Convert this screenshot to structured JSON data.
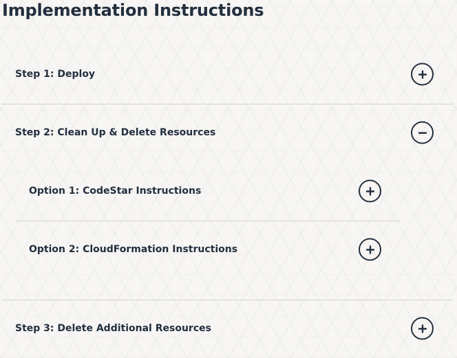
{
  "page": {
    "title": "Implementation Instructions"
  },
  "steps": [
    {
      "label": "Step 1: Deploy",
      "state": "collapsed",
      "toggle_icon": "plus-icon"
    },
    {
      "label": "Step 2: Clean Up & Delete Resources",
      "state": "expanded",
      "toggle_icon": "minus-icon",
      "options": [
        {
          "label": "Option 1: CodeStar Instructions",
          "state": "collapsed",
          "toggle_icon": "plus-icon"
        },
        {
          "label": "Option 2: CloudFormation Instructions",
          "state": "collapsed",
          "toggle_icon": "plus-icon"
        }
      ]
    },
    {
      "label": "Step 3: Delete Additional Resources",
      "state": "collapsed",
      "toggle_icon": "plus-icon"
    }
  ],
  "colors": {
    "text": "#232f3e",
    "divider": "#d5d3d0",
    "background": "#f7f6f4"
  }
}
